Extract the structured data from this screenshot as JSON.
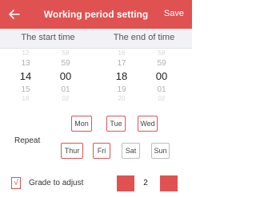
{
  "header": {
    "back_icon": "back-arrow-icon",
    "title": "Working period setting",
    "save_label": "Save",
    "color": "#e05252"
  },
  "tabs": {
    "start": "The start time",
    "end": "The end of time"
  },
  "start_picker": {
    "hours": [
      "12",
      "13",
      "14",
      "15",
      "16"
    ],
    "minutes": [
      "58",
      "59",
      "00",
      "01",
      "02"
    ],
    "selected_hour": "14",
    "selected_minute": "00"
  },
  "end_picker": {
    "hours": [
      "16",
      "17",
      "18",
      "19",
      "20"
    ],
    "minutes": [
      "58",
      "59",
      "00",
      "01",
      "02"
    ],
    "selected_hour": "18",
    "selected_minute": "00"
  },
  "repeat": {
    "label": "Repeat",
    "days": [
      {
        "label": "Mon",
        "selected": true
      },
      {
        "label": "Tue",
        "selected": true
      },
      {
        "label": "Wed",
        "selected": true
      },
      {
        "label": "Thur",
        "selected": true
      },
      {
        "label": "Fri",
        "selected": true
      },
      {
        "label": "Sat",
        "selected": false
      },
      {
        "label": "Sun",
        "selected": false
      }
    ]
  },
  "grade": {
    "checkbox_mark": "√",
    "checked": true,
    "label": "Grade to adjust",
    "value": "2"
  }
}
